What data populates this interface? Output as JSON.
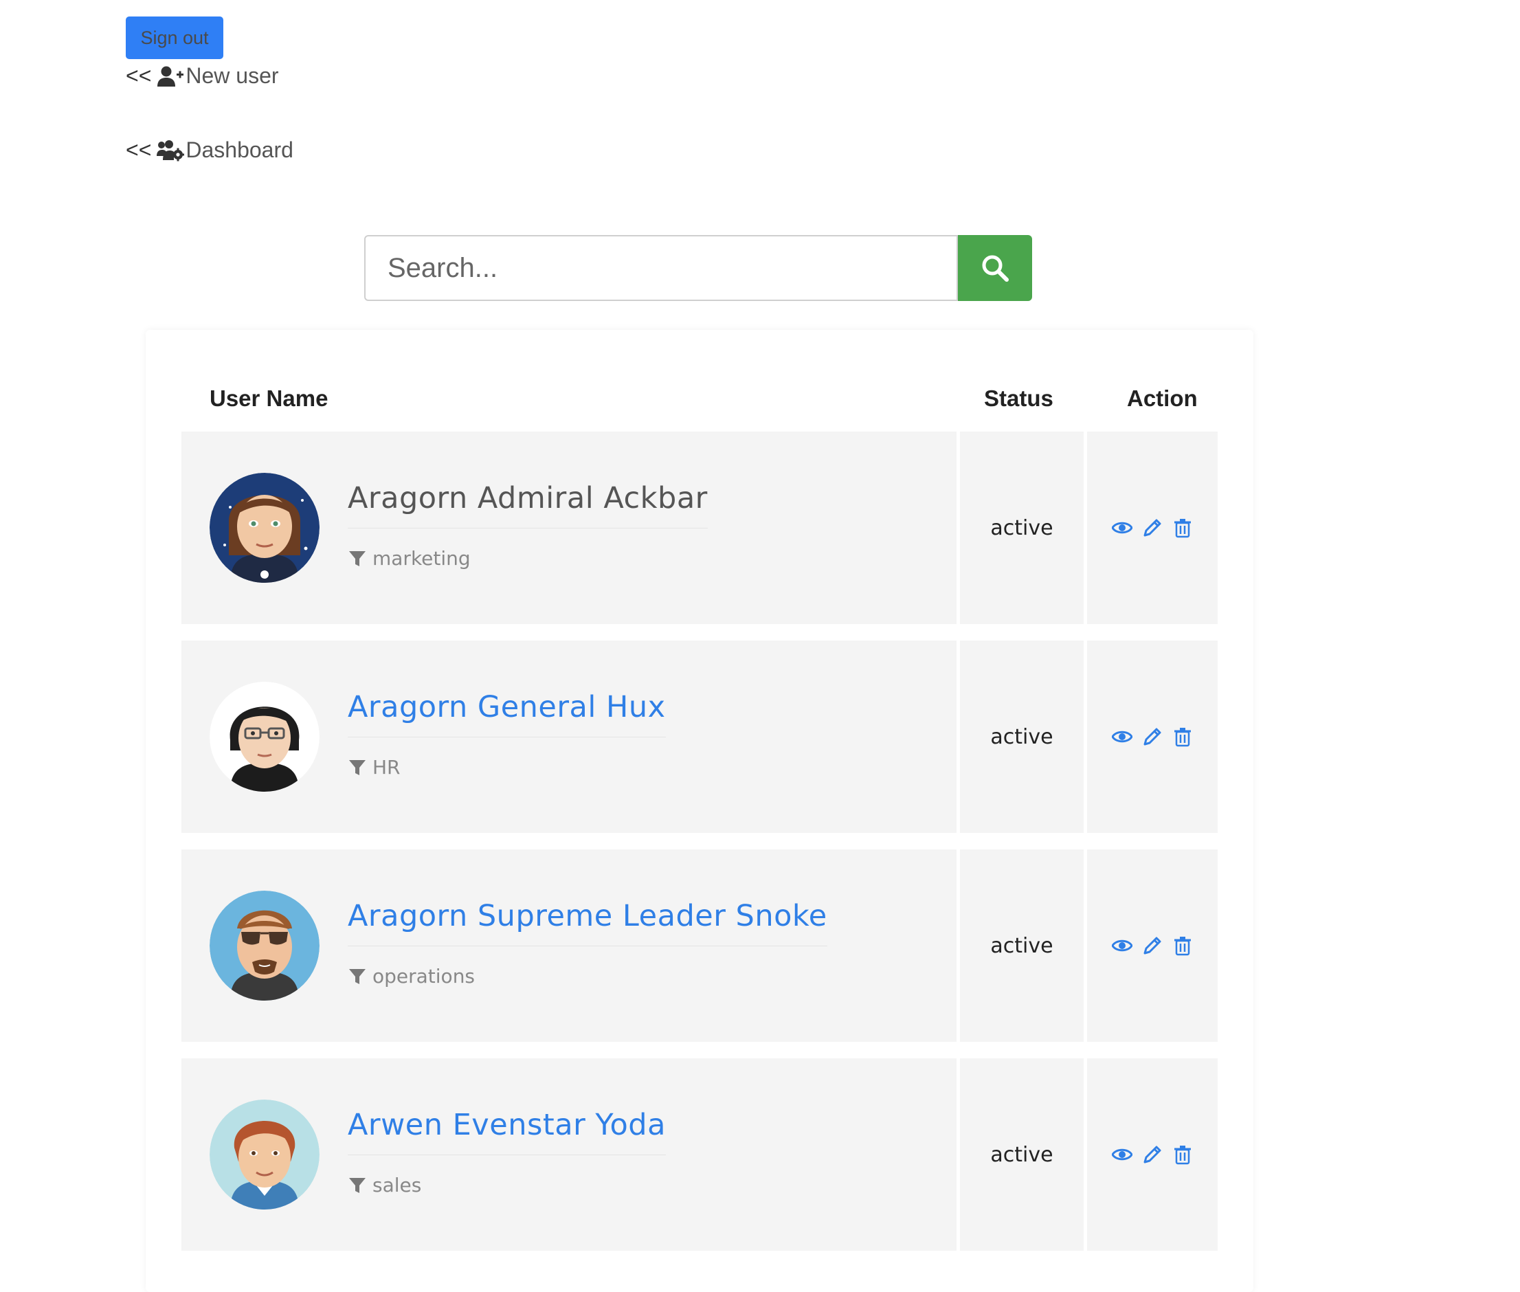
{
  "nav": {
    "signout_label": "Sign out",
    "back_prefix": "<<",
    "new_user_label": "New user",
    "dashboard_label": "Dashboard"
  },
  "search": {
    "placeholder": "Search...",
    "icon": "search-icon"
  },
  "table": {
    "headers": {
      "user_name": "User Name",
      "status": "Status",
      "action": "Action"
    },
    "rows": [
      {
        "name": "Aragorn Admiral Ackbar",
        "department": "marketing",
        "status": "active",
        "name_style": "plain"
      },
      {
        "name": "Aragorn General Hux",
        "department": "HR",
        "status": "active",
        "name_style": "link"
      },
      {
        "name": "Aragorn Supreme Leader Snoke",
        "department": "operations",
        "status": "active",
        "name_style": "link"
      },
      {
        "name": "Arwen Evenstar Yoda",
        "department": "sales",
        "status": "active",
        "name_style": "link"
      }
    ],
    "action_icons": [
      "eye-icon",
      "pencil-icon",
      "trash-icon"
    ]
  },
  "colors": {
    "primary": "#2f7ff5",
    "link": "#2f7fe6",
    "search_button": "#4aa54c",
    "row_background": "#f4f4f4"
  }
}
